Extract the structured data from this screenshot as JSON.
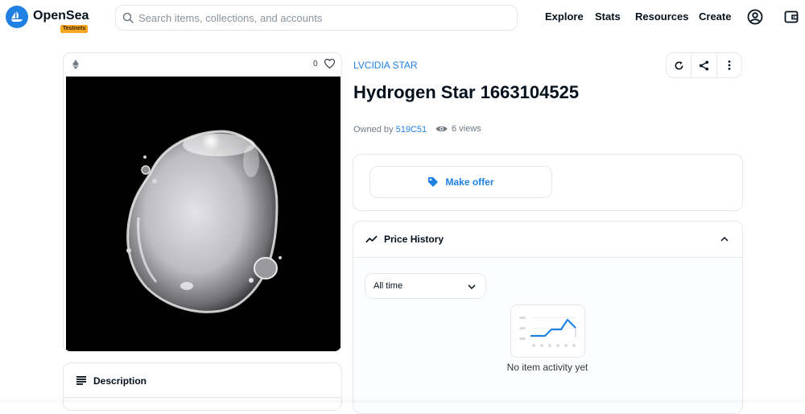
{
  "header": {
    "brand": "OpenSea",
    "badge": "Testnets",
    "search_placeholder": "Search items, collections, and accounts",
    "nav": [
      "Explore",
      "Stats",
      "Resources",
      "Create"
    ],
    "icons": [
      "profile-icon",
      "wallet-icon"
    ]
  },
  "item": {
    "chain_icon": "ethereum-icon",
    "favorites": "0",
    "collection": "LVCIDIA STAR",
    "title": "Hydrogen Star 1663104525",
    "owned_by_label": "Owned by",
    "owner": "519C51",
    "views": "6 views"
  },
  "actions": {
    "icons": [
      "refresh-icon",
      "share-icon",
      "more-icon"
    ]
  },
  "offer": {
    "label": "Make offer"
  },
  "price_history": {
    "title": "Price History",
    "period": "All time",
    "empty_text": "No item activity yet"
  },
  "description": {
    "title": "Description"
  },
  "colors": {
    "accent": "#2081e2",
    "text": "#04111d",
    "muted": "#707a83",
    "border": "#e5e8eb",
    "badge": "#f5a623"
  }
}
